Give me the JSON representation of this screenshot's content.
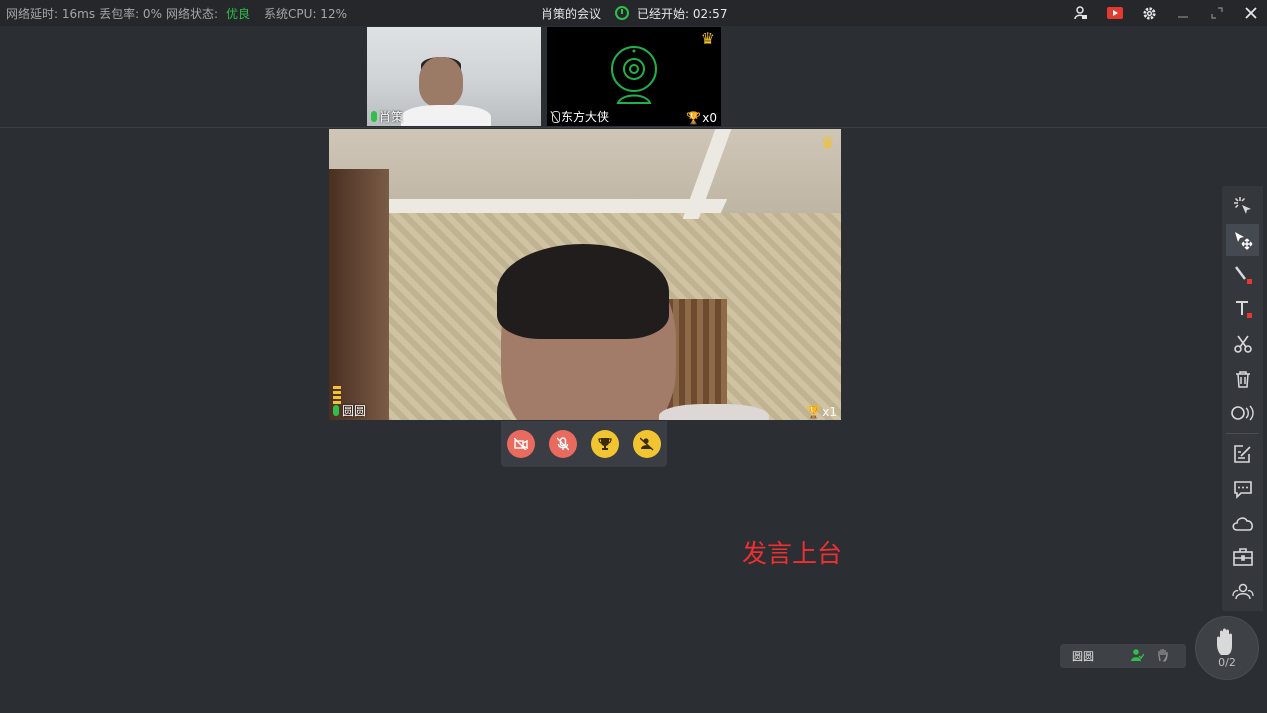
{
  "stats": {
    "latency_label": "网络延时: 16ms",
    "loss_label": "丢包率: 0%",
    "network_label": "网络状态:",
    "network_value": "优良",
    "cpu_label": "系统CPU: 12%"
  },
  "header": {
    "meeting_title": "肖策的会议",
    "elapsed_label": "已经开始: 02:57"
  },
  "thumbnails": [
    {
      "name": "肖策",
      "mic": "on"
    },
    {
      "name": "东方大侠",
      "mic": "muted",
      "trophies": "x0",
      "host": true
    }
  ],
  "main_video": {
    "name": "圆圆",
    "trophies": "x1",
    "mic": "on"
  },
  "controls": [
    {
      "icon": "camera-off-icon",
      "color": "#e96a5e"
    },
    {
      "icon": "mic-off-icon",
      "color": "#e96a5e"
    },
    {
      "icon": "trophy-icon",
      "color": "#f0c531"
    },
    {
      "icon": "stage-down-icon",
      "color": "#f0c531"
    }
  ],
  "caption": "发言上台",
  "hand_raise": {
    "user_name": "圆圆",
    "count": "0/2"
  },
  "colors": {
    "good": "#2fbf4a",
    "accent_red": "#f03030",
    "crown": "#f2c230"
  }
}
